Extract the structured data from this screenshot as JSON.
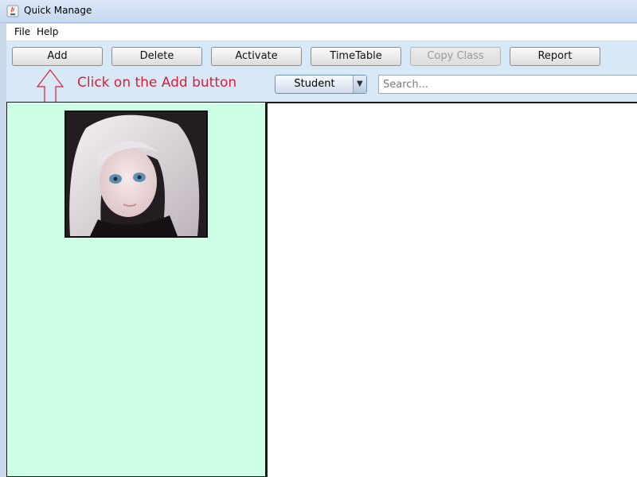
{
  "window": {
    "title": "Quick Manage",
    "icon": "java-app-icon"
  },
  "menubar": {
    "items": [
      "File",
      "Help"
    ]
  },
  "toolbar": {
    "buttons": [
      {
        "label": "Add",
        "enabled": true
      },
      {
        "label": "Delete",
        "enabled": true
      },
      {
        "label": "Activate",
        "enabled": true
      },
      {
        "label": "TimeTable",
        "enabled": true
      },
      {
        "label": "Copy Class",
        "enabled": false
      },
      {
        "label": "Report",
        "enabled": true
      }
    ]
  },
  "annotation": {
    "text": "Click on the Add button",
    "color": "#d8203a"
  },
  "filter": {
    "selected": "Student"
  },
  "search": {
    "placeholder": "Search..."
  },
  "colors": {
    "left_panel": "#ccffe6",
    "toolbar": "#d7e8f7"
  }
}
